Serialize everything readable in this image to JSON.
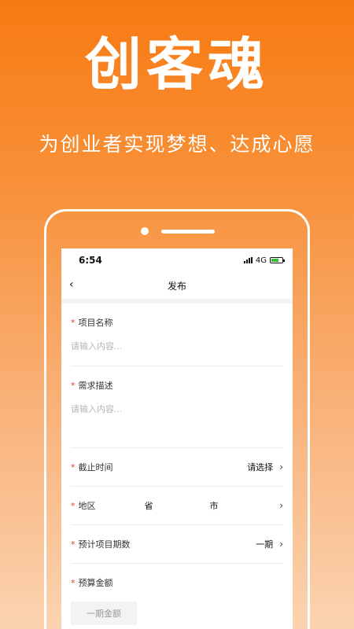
{
  "hero": {
    "title": "创客魂",
    "subtitle": "为创业者实现梦想、达成心愿"
  },
  "status_bar": {
    "time": "6:54",
    "network": "4G"
  },
  "nav": {
    "back_icon": "chevron-left-icon",
    "title": "发布"
  },
  "form": {
    "required_mark": "*",
    "project_name": {
      "label": "项目名称",
      "placeholder": "请输入内容..."
    },
    "requirement_desc": {
      "label": "需求描述",
      "placeholder": "请输入内容..."
    },
    "deadline": {
      "label": "截止时间",
      "value": "请选择"
    },
    "region": {
      "label": "地区",
      "province": "省",
      "city": "市"
    },
    "phases": {
      "label": "预计项目期数",
      "value": "一期"
    },
    "budget": {
      "label": "预算金额",
      "input_placeholder": "一期金额"
    }
  },
  "colors": {
    "accent": "#f77a12",
    "required": "#e03a2f",
    "battery": "#3bbf3b"
  }
}
